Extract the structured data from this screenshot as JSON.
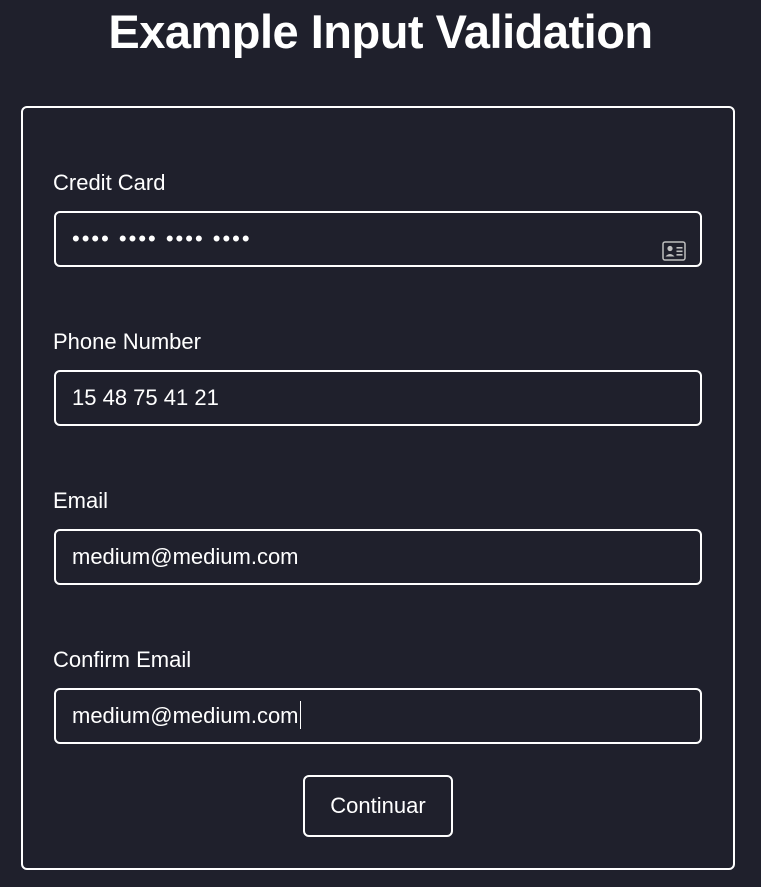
{
  "page": {
    "title": "Example Input Validation"
  },
  "form": {
    "credit_card": {
      "label": "Credit Card",
      "value": "•••• •••• •••• ••••",
      "icon": "contact-card-icon"
    },
    "phone": {
      "label": "Phone Number",
      "value": "15 48 75 41 21"
    },
    "email": {
      "label": "Email",
      "value": "medium@medium.com"
    },
    "confirm_email": {
      "label": "Confirm Email",
      "value": "medium@medium.com"
    },
    "submit_label": "Continuar"
  },
  "colors": {
    "background": "#1f202c",
    "foreground": "#ffffff"
  }
}
